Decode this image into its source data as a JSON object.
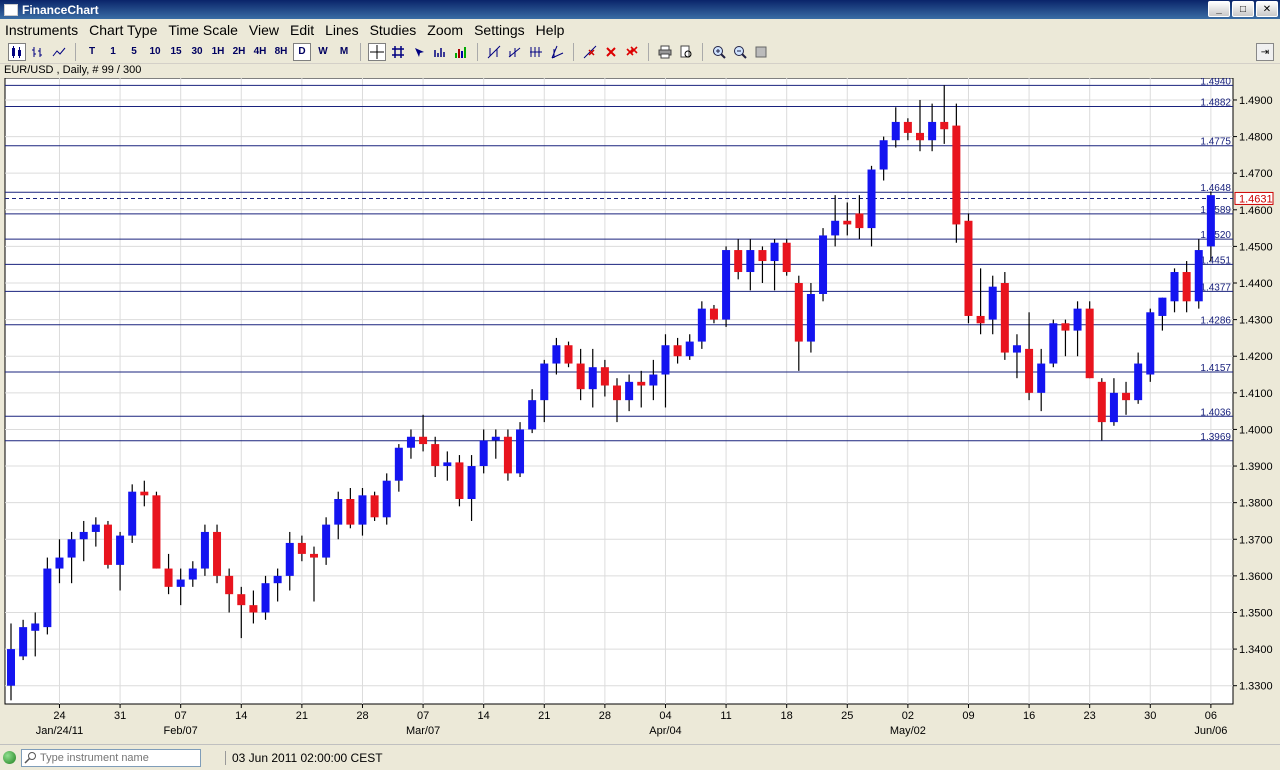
{
  "window": {
    "title": "FinanceChart"
  },
  "menu": [
    "Instruments",
    "Chart Type",
    "Time Scale",
    "View",
    "Edit",
    "Lines",
    "Studies",
    "Zoom",
    "Settings",
    "Help"
  ],
  "toolbar": {
    "timeframes": [
      "T",
      "1",
      "5",
      "10",
      "15",
      "30",
      "1H",
      "2H",
      "4H",
      "8H",
      "D",
      "W",
      "M"
    ],
    "selected_timeframe": "D"
  },
  "chart_info": "EUR/USD , Daily, # 99 / 300",
  "status": {
    "search_placeholder": "Type instrument name",
    "datetime": "03 Jun 2011 02:00:00 CEST"
  },
  "chart_data": {
    "type": "candlestick",
    "symbol": "EUR/USD",
    "period": "Daily",
    "ylim": [
      1.325,
      1.496
    ],
    "y_ticks": [
      "1.3300",
      "1.3400",
      "1.3500",
      "1.3600",
      "1.3700",
      "1.3800",
      "1.3900",
      "1.4000",
      "1.4100",
      "1.4200",
      "1.4300",
      "1.4400",
      "1.4500",
      "1.4600",
      "1.4700",
      "1.4800",
      "1.4900"
    ],
    "x_ticks": [
      {
        "day": "24",
        "month": "Jan/24/11",
        "index": 4
      },
      {
        "day": "31",
        "month": "",
        "index": 9
      },
      {
        "day": "07",
        "month": "Feb/07",
        "index": 14
      },
      {
        "day": "14",
        "month": "",
        "index": 19
      },
      {
        "day": "21",
        "month": "",
        "index": 24
      },
      {
        "day": "28",
        "month": "",
        "index": 29
      },
      {
        "day": "07",
        "month": "Mar/07",
        "index": 34
      },
      {
        "day": "14",
        "month": "",
        "index": 39
      },
      {
        "day": "21",
        "month": "",
        "index": 44
      },
      {
        "day": "28",
        "month": "",
        "index": 49
      },
      {
        "day": "04",
        "month": "Apr/04",
        "index": 54
      },
      {
        "day": "11",
        "month": "",
        "index": 59
      },
      {
        "day": "18",
        "month": "",
        "index": 64
      },
      {
        "day": "25",
        "month": "",
        "index": 69
      },
      {
        "day": "02",
        "month": "May/02",
        "index": 74
      },
      {
        "day": "09",
        "month": "",
        "index": 79
      },
      {
        "day": "16",
        "month": "",
        "index": 84
      },
      {
        "day": "23",
        "month": "",
        "index": 89
      },
      {
        "day": "30",
        "month": "",
        "index": 94
      },
      {
        "day": "06",
        "month": "Jun/06",
        "index": 99
      }
    ],
    "levels": [
      "1.4940",
      "1.4882",
      "1.4775",
      "1.4648",
      "1.4589",
      "1.4520",
      "1.4451",
      "1.4377",
      "1.4286",
      "1.4157",
      "1.4036",
      "1.3969"
    ],
    "current_price": "1.4631",
    "candles": [
      [
        1.33,
        1.347,
        1.326,
        1.34
      ],
      [
        1.338,
        1.348,
        1.337,
        1.346
      ],
      [
        1.345,
        1.35,
        1.338,
        1.347
      ],
      [
        1.346,
        1.365,
        1.344,
        1.362
      ],
      [
        1.362,
        1.37,
        1.358,
        1.365
      ],
      [
        1.365,
        1.372,
        1.358,
        1.37
      ],
      [
        1.37,
        1.375,
        1.364,
        1.372
      ],
      [
        1.372,
        1.376,
        1.368,
        1.374
      ],
      [
        1.374,
        1.375,
        1.362,
        1.363
      ],
      [
        1.363,
        1.372,
        1.356,
        1.371
      ],
      [
        1.371,
        1.385,
        1.369,
        1.383
      ],
      [
        1.383,
        1.386,
        1.379,
        1.382
      ],
      [
        1.382,
        1.383,
        1.362,
        1.362
      ],
      [
        1.362,
        1.366,
        1.355,
        1.357
      ],
      [
        1.357,
        1.362,
        1.352,
        1.359
      ],
      [
        1.359,
        1.364,
        1.357,
        1.362
      ],
      [
        1.362,
        1.374,
        1.36,
        1.372
      ],
      [
        1.372,
        1.374,
        1.358,
        1.36
      ],
      [
        1.36,
        1.362,
        1.35,
        1.355
      ],
      [
        1.355,
        1.357,
        1.343,
        1.352
      ],
      [
        1.352,
        1.356,
        1.347,
        1.35
      ],
      [
        1.35,
        1.36,
        1.348,
        1.358
      ],
      [
        1.358,
        1.362,
        1.353,
        1.36
      ],
      [
        1.36,
        1.372,
        1.356,
        1.369
      ],
      [
        1.369,
        1.371,
        1.364,
        1.366
      ],
      [
        1.366,
        1.368,
        1.353,
        1.365
      ],
      [
        1.365,
        1.376,
        1.363,
        1.374
      ],
      [
        1.374,
        1.383,
        1.37,
        1.381
      ],
      [
        1.381,
        1.384,
        1.373,
        1.374
      ],
      [
        1.374,
        1.384,
        1.371,
        1.382
      ],
      [
        1.382,
        1.383,
        1.375,
        1.376
      ],
      [
        1.376,
        1.388,
        1.374,
        1.386
      ],
      [
        1.386,
        1.396,
        1.383,
        1.395
      ],
      [
        1.395,
        1.4,
        1.392,
        1.398
      ],
      [
        1.398,
        1.404,
        1.394,
        1.396
      ],
      [
        1.396,
        1.398,
        1.387,
        1.39
      ],
      [
        1.39,
        1.394,
        1.386,
        1.391
      ],
      [
        1.391,
        1.393,
        1.379,
        1.381
      ],
      [
        1.381,
        1.393,
        1.375,
        1.39
      ],
      [
        1.39,
        1.4,
        1.388,
        1.397
      ],
      [
        1.397,
        1.4,
        1.392,
        1.398
      ],
      [
        1.398,
        1.4,
        1.386,
        1.388
      ],
      [
        1.388,
        1.402,
        1.387,
        1.4
      ],
      [
        1.4,
        1.411,
        1.399,
        1.408
      ],
      [
        1.408,
        1.419,
        1.402,
        1.418
      ],
      [
        1.418,
        1.425,
        1.415,
        1.423
      ],
      [
        1.423,
        1.424,
        1.417,
        1.418
      ],
      [
        1.418,
        1.422,
        1.408,
        1.411
      ],
      [
        1.411,
        1.422,
        1.406,
        1.417
      ],
      [
        1.417,
        1.419,
        1.409,
        1.412
      ],
      [
        1.412,
        1.414,
        1.402,
        1.408
      ],
      [
        1.408,
        1.415,
        1.405,
        1.413
      ],
      [
        1.413,
        1.416,
        1.406,
        1.412
      ],
      [
        1.412,
        1.419,
        1.408,
        1.415
      ],
      [
        1.415,
        1.426,
        1.406,
        1.423
      ],
      [
        1.423,
        1.425,
        1.418,
        1.42
      ],
      [
        1.42,
        1.426,
        1.419,
        1.424
      ],
      [
        1.424,
        1.435,
        1.422,
        1.433
      ],
      [
        1.433,
        1.434,
        1.429,
        1.43
      ],
      [
        1.43,
        1.45,
        1.428,
        1.449
      ],
      [
        1.449,
        1.452,
        1.441,
        1.443
      ],
      [
        1.443,
        1.452,
        1.438,
        1.449
      ],
      [
        1.449,
        1.45,
        1.44,
        1.446
      ],
      [
        1.446,
        1.452,
        1.438,
        1.451
      ],
      [
        1.451,
        1.452,
        1.442,
        1.443
      ],
      [
        1.44,
        1.442,
        1.416,
        1.424
      ],
      [
        1.424,
        1.44,
        1.421,
        1.437
      ],
      [
        1.437,
        1.455,
        1.435,
        1.453
      ],
      [
        1.453,
        1.464,
        1.45,
        1.457
      ],
      [
        1.457,
        1.462,
        1.453,
        1.456
      ],
      [
        1.459,
        1.464,
        1.452,
        1.455
      ],
      [
        1.455,
        1.472,
        1.45,
        1.471
      ],
      [
        1.471,
        1.48,
        1.468,
        1.479
      ],
      [
        1.479,
        1.488,
        1.477,
        1.484
      ],
      [
        1.484,
        1.485,
        1.479,
        1.481
      ],
      [
        1.481,
        1.49,
        1.476,
        1.479
      ],
      [
        1.479,
        1.489,
        1.476,
        1.484
      ],
      [
        1.484,
        1.494,
        1.478,
        1.482
      ],
      [
        1.483,
        1.489,
        1.451,
        1.456
      ],
      [
        1.457,
        1.459,
        1.429,
        1.431
      ],
      [
        1.431,
        1.444,
        1.426,
        1.429
      ],
      [
        1.43,
        1.442,
        1.426,
        1.439
      ],
      [
        1.44,
        1.443,
        1.419,
        1.421
      ],
      [
        1.421,
        1.426,
        1.414,
        1.423
      ],
      [
        1.422,
        1.432,
        1.408,
        1.41
      ],
      [
        1.41,
        1.422,
        1.405,
        1.418
      ],
      [
        1.418,
        1.43,
        1.417,
        1.429
      ],
      [
        1.429,
        1.43,
        1.42,
        1.427
      ],
      [
        1.427,
        1.435,
        1.42,
        1.433
      ],
      [
        1.433,
        1.435,
        1.414,
        1.414
      ],
      [
        1.413,
        1.414,
        1.397,
        1.402
      ],
      [
        1.402,
        1.414,
        1.401,
        1.41
      ],
      [
        1.41,
        1.413,
        1.404,
        1.408
      ],
      [
        1.408,
        1.421,
        1.407,
        1.418
      ],
      [
        1.415,
        1.433,
        1.413,
        1.432
      ],
      [
        1.431,
        1.436,
        1.427,
        1.436
      ],
      [
        1.435,
        1.444,
        1.432,
        1.443
      ],
      [
        1.443,
        1.446,
        1.432,
        1.435
      ],
      [
        1.435,
        1.452,
        1.433,
        1.449
      ],
      [
        1.45,
        1.465,
        1.446,
        1.464
      ]
    ]
  }
}
